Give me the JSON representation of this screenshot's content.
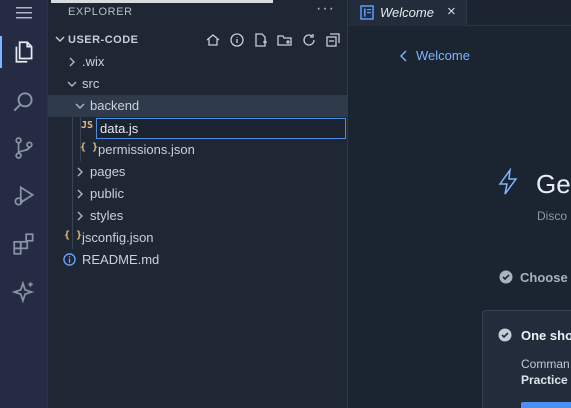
{
  "activity_bar": {
    "items": [
      "explorer",
      "search",
      "source-control",
      "run-debug",
      "extensions",
      "ai-assistant"
    ]
  },
  "sidebar": {
    "title": "EXPLORER",
    "more": "···",
    "section_title": "USER-CODE",
    "tree": [
      {
        "label": ".wix",
        "type": "folder",
        "expanded": false
      },
      {
        "label": "src",
        "type": "folder",
        "expanded": true
      },
      {
        "label": "backend",
        "type": "folder",
        "expanded": true
      },
      {
        "label": "data.js",
        "type": "file",
        "icon": "JS",
        "renaming": true
      },
      {
        "label": "permissions.json",
        "type": "file",
        "icon": "{ }"
      },
      {
        "label": "pages",
        "type": "folder",
        "expanded": false
      },
      {
        "label": "public",
        "type": "folder",
        "expanded": false
      },
      {
        "label": "styles",
        "type": "folder",
        "expanded": false
      },
      {
        "label": "jsconfig.json",
        "type": "file",
        "icon": "{ }"
      },
      {
        "label": "README.md",
        "type": "file",
        "icon": "i"
      }
    ]
  },
  "editor": {
    "tab_label": "Welcome",
    "tab_close": "×",
    "back_label": "Welcome",
    "heading": "Get",
    "subheading": "Disco",
    "choose_label": "Choose",
    "card_title": "One sho",
    "card_line1": "Comman",
    "card_line2": "Practice"
  },
  "colors": {
    "accent": "#7fb4ff",
    "js_icon": "#e5c07b",
    "json_icon": "#e5c07b",
    "info_icon": "#6fa8ff",
    "button": "#4a8ff5"
  }
}
